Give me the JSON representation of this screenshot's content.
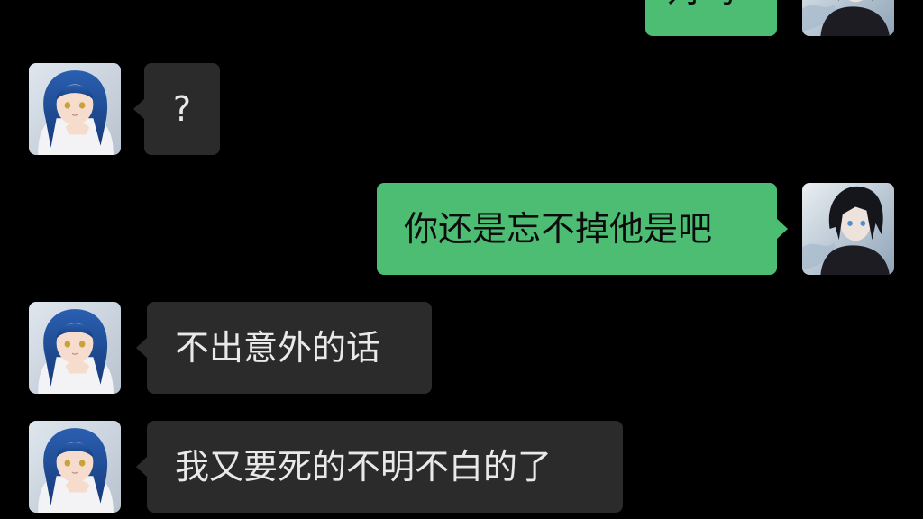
{
  "colors": {
    "background": "#000000",
    "incoming_bubble": "#2b2b2b",
    "outgoing_bubble": "#4dbd74",
    "incoming_text": "#e9e9e9",
    "outgoing_text": "#0c0c0c"
  },
  "participants": {
    "contact": {
      "avatar_icon": "blue-haired-girl-avatar-icon"
    },
    "me": {
      "avatar_icon": "dark-haired-boy-avatar-icon"
    }
  },
  "messages": [
    {
      "from": "me",
      "text": "对吗"
    },
    {
      "from": "contact",
      "text": "?"
    },
    {
      "from": "me",
      "text": "你还是忘不掉他是吧"
    },
    {
      "from": "contact",
      "text": "不出意外的话"
    },
    {
      "from": "contact",
      "text": "我又要死的不明不白的了"
    }
  ]
}
